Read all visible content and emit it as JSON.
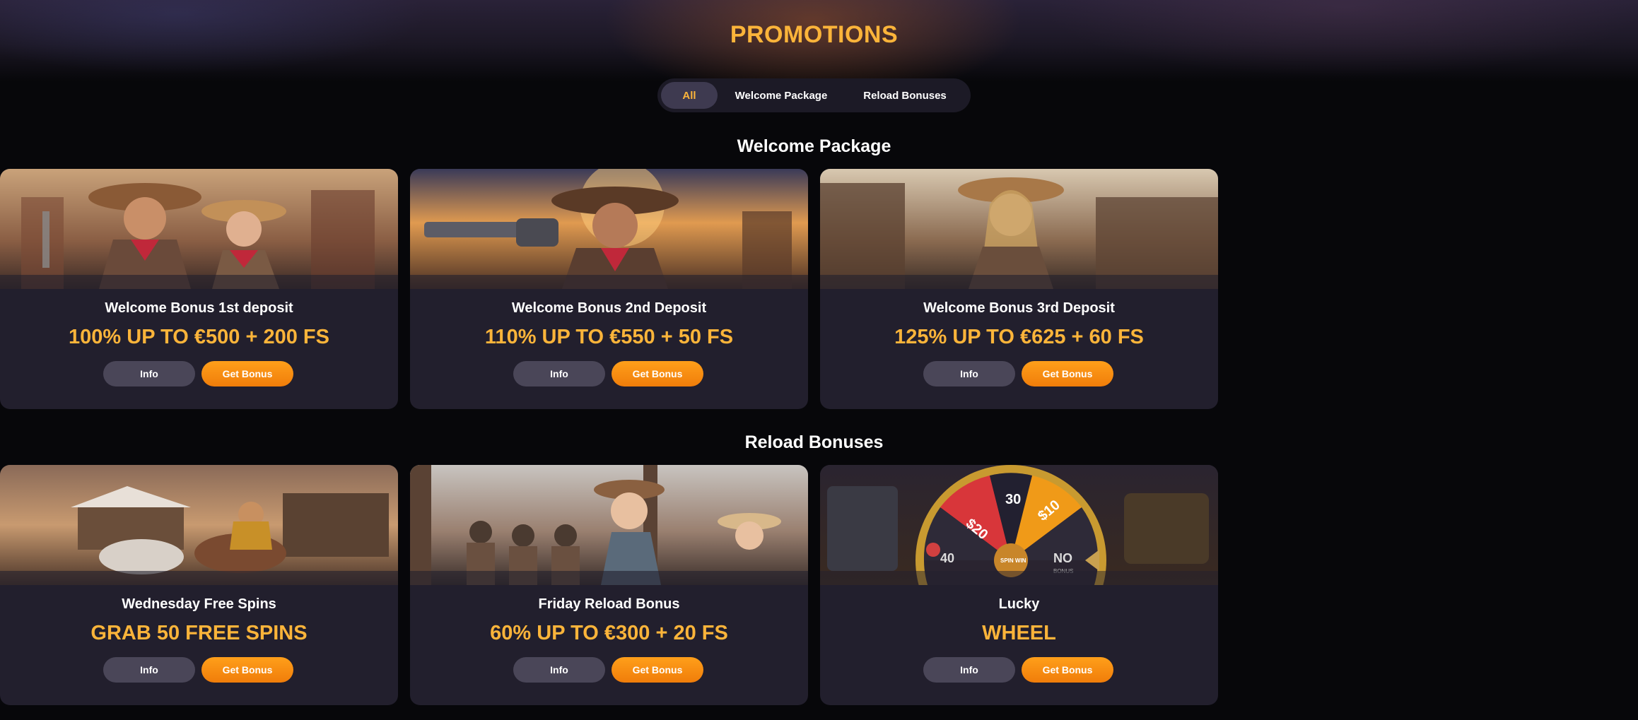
{
  "page": {
    "title": "PROMOTIONS"
  },
  "tabs": [
    {
      "label": "All",
      "active": true
    },
    {
      "label": "Welcome Package",
      "active": false
    },
    {
      "label": "Reload Bonuses",
      "active": false
    }
  ],
  "sections": [
    {
      "title": "Welcome Package",
      "cards": [
        {
          "name": "Welcome Bonus 1st deposit",
          "offer": "100% UP TO €500 + 200 FS",
          "info_label": "Info",
          "cta_label": "Get Bonus"
        },
        {
          "name": "Welcome Bonus 2nd Deposit",
          "offer": "110% UP TO €550 + 50 FS",
          "info_label": "Info",
          "cta_label": "Get Bonus"
        },
        {
          "name": "Welcome Bonus 3rd Deposit",
          "offer": "125% UP TO €625 + 60 FS",
          "info_label": "Info",
          "cta_label": "Get Bonus"
        }
      ]
    },
    {
      "title": "Reload Bonuses",
      "cards": [
        {
          "name": "Wednesday Free Spins",
          "offer": "GRAB 50 FREE SPINS",
          "info_label": "Info",
          "cta_label": "Get Bonus"
        },
        {
          "name": "Friday Reload Bonus",
          "offer": "60% UP TO €300 + 20 FS",
          "info_label": "Info",
          "cta_label": "Get Bonus"
        },
        {
          "name": "Lucky",
          "offer": "WHEEL",
          "info_label": "Info",
          "cta_label": "Get Bonus"
        }
      ]
    }
  ],
  "wheel": {
    "segments": [
      "$20",
      "30",
      "$10",
      "NO",
      "40"
    ],
    "sub_labels": [
      "BONUS",
      "SPIN WIN"
    ]
  },
  "colors": {
    "accent": "#fbb43a",
    "button_primary": "#f58a0f",
    "button_secondary": "#4a4658",
    "card_bg": "#221f2d",
    "page_bg": "#07070a"
  }
}
